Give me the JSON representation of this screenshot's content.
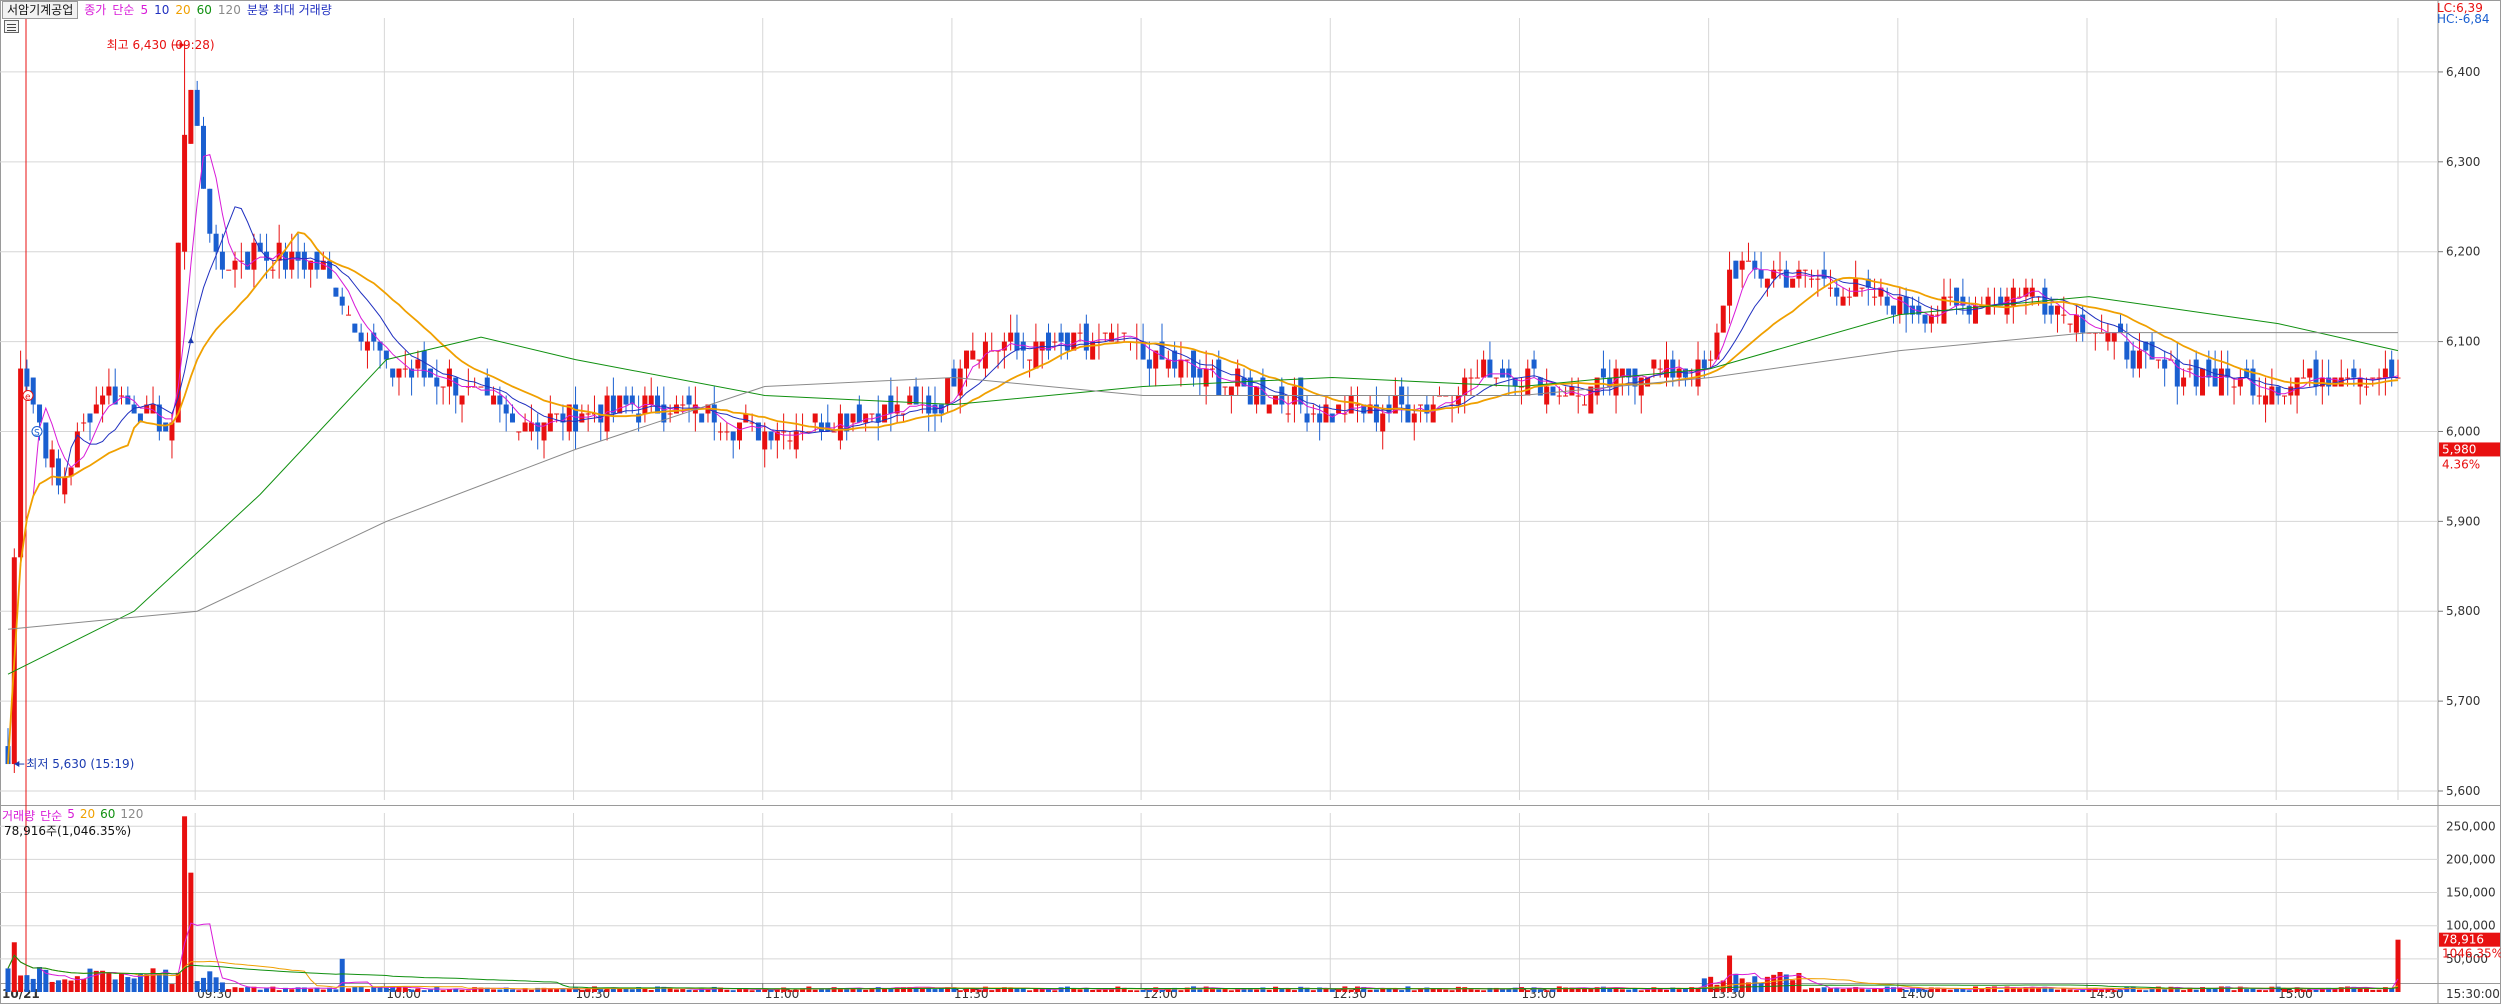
{
  "header": {
    "stock_name": "서암기계공업",
    "price_label": "종가",
    "ma_kind": "단순",
    "ma_periods": [
      "5",
      "10",
      "20",
      "60",
      "120"
    ],
    "ma_colors": [
      "#d81bd8",
      "#2030c0",
      "#f0a000",
      "#109010",
      "#8a8a8a"
    ],
    "chart_desc": "분봉 최대 거래량",
    "lc_label": "LC:6,39",
    "hc_label": "HC:-6,84"
  },
  "annotations": {
    "high_text": "최고 6,430 (09:28)",
    "low_text": "최저 5,630 (15:19)",
    "marker_e": "e",
    "marker_s": "S"
  },
  "price_axis": {
    "ticks": [
      "6,400",
      "6,300",
      "6,200",
      "6,100",
      "6,000",
      "5,900",
      "5,800",
      "5,700",
      "5,600"
    ],
    "current_price": "5,980",
    "current_change": "4.36%"
  },
  "volume_panel": {
    "legend_title": "거래량",
    "ma_kind": "단순",
    "ma_periods": [
      "5",
      "20",
      "60",
      "120"
    ],
    "current_volume_text": "78,916주(1,046.35%)",
    "ticks": [
      "250,000",
      "200,000",
      "150,000",
      "100,000",
      "50,000"
    ],
    "current_volume": "78,916",
    "current_pct": "1046.35%"
  },
  "time_axis": {
    "date_label": "10/21",
    "labels": [
      "09:30",
      "10:00",
      "10:30",
      "11:00",
      "11:30",
      "12:00",
      "12:30",
      "13:00",
      "13:30",
      "14:00",
      "14:30",
      "15:00",
      "15:30:00"
    ]
  },
  "colors": {
    "up": "#e81010",
    "down": "#1a5fd0",
    "grid": "#d6d6d6",
    "axis_text": "#333333"
  },
  "chart_data": {
    "type": "candlestick",
    "title": "서암기계공업",
    "x_unit": "minute",
    "y_range": [
      5590,
      6460
    ],
    "volume_range": [
      0,
      270000
    ],
    "key_points": [
      {
        "time": "09:00",
        "price": 5630
      },
      {
        "time": "09:02",
        "price": 6080
      },
      {
        "time": "09:08",
        "price": 5940
      },
      {
        "time": "09:15",
        "price": 6050
      },
      {
        "time": "09:26",
        "price": 6000
      },
      {
        "time": "09:28",
        "price": 6430
      },
      {
        "time": "09:33",
        "price": 6180
      },
      {
        "time": "09:40",
        "price": 6200
      },
      {
        "time": "09:50",
        "price": 6180
      },
      {
        "time": "10:00",
        "price": 6070
      },
      {
        "time": "10:10",
        "price": 6060
      },
      {
        "time": "10:20",
        "price": 6010
      },
      {
        "time": "10:30",
        "price": 6020
      },
      {
        "time": "10:45",
        "price": 6030
      },
      {
        "time": "11:00",
        "price": 6000
      },
      {
        "time": "11:15",
        "price": 6020
      },
      {
        "time": "11:28",
        "price": 6030
      },
      {
        "time": "11:32",
        "price": 6100
      },
      {
        "time": "11:45",
        "price": 6090
      },
      {
        "time": "11:55",
        "price": 6100
      },
      {
        "time": "12:05",
        "price": 6070
      },
      {
        "time": "12:20",
        "price": 6040
      },
      {
        "time": "12:30",
        "price": 6020
      },
      {
        "time": "12:45",
        "price": 6030
      },
      {
        "time": "12:55",
        "price": 6070
      },
      {
        "time": "13:10",
        "price": 6040
      },
      {
        "time": "13:20",
        "price": 6070
      },
      {
        "time": "13:30",
        "price": 6070
      },
      {
        "time": "13:33",
        "price": 6180
      },
      {
        "time": "13:45",
        "price": 6170
      },
      {
        "time": "13:55",
        "price": 6150
      },
      {
        "time": "14:05",
        "price": 6130
      },
      {
        "time": "14:20",
        "price": 6160
      },
      {
        "time": "14:30",
        "price": 6120
      },
      {
        "time": "14:40",
        "price": 6070
      },
      {
        "time": "14:50",
        "price": 6060
      },
      {
        "time": "15:00",
        "price": 6050
      },
      {
        "time": "15:10",
        "price": 6070
      },
      {
        "time": "15:19",
        "price": 6060
      }
    ],
    "ma_lines": [
      {
        "name": "60",
        "color": "#109010",
        "points": [
          [
            "09:00",
            5730
          ],
          [
            "09:20",
            5800
          ],
          [
            "09:40",
            5930
          ],
          [
            "10:00",
            6080
          ],
          [
            "10:15",
            6105
          ],
          [
            "10:30",
            6080
          ],
          [
            "11:00",
            6040
          ],
          [
            "11:30",
            6030
          ],
          [
            "12:00",
            6050
          ],
          [
            "12:30",
            6060
          ],
          [
            "13:00",
            6050
          ],
          [
            "13:30",
            6070
          ],
          [
            "14:00",
            6130
          ],
          [
            "14:30",
            6150
          ],
          [
            "15:00",
            6120
          ],
          [
            "15:19",
            6090
          ]
        ]
      },
      {
        "name": "120",
        "color": "#8a8a8a",
        "points": [
          [
            "09:00",
            5780
          ],
          [
            "09:30",
            5800
          ],
          [
            "10:00",
            5900
          ],
          [
            "10:30",
            5980
          ],
          [
            "11:00",
            6050
          ],
          [
            "11:30",
            6060
          ],
          [
            "12:00",
            6040
          ],
          [
            "12:30",
            6040
          ],
          [
            "13:00",
            6040
          ],
          [
            "13:30",
            6060
          ],
          [
            "14:00",
            6090
          ],
          [
            "14:30",
            6110
          ],
          [
            "15:00",
            6110
          ],
          [
            "15:19",
            6110
          ]
        ]
      }
    ],
    "volume_key_points": [
      {
        "time": "09:01",
        "volume": 75000
      },
      {
        "time": "09:28",
        "volume": 265000
      },
      {
        "time": "09:29",
        "volume": 180000
      },
      {
        "time": "09:53",
        "volume": 50000
      },
      {
        "time": "13:33",
        "volume": 55000
      },
      {
        "time": "15:19",
        "volume": 78916
      }
    ]
  }
}
